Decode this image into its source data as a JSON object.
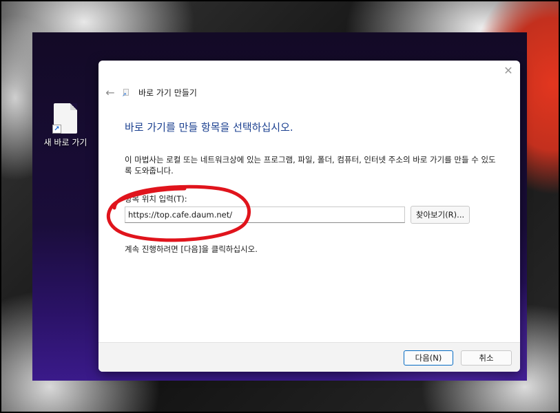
{
  "desktop": {
    "icon_label": "새 바로 가기"
  },
  "dialog": {
    "close_glyph": "✕",
    "back_glyph": "←",
    "title": "바로 가기 만들기",
    "heading": "바로 가기를 만들 항목을 선택하십시오.",
    "description": "이 마법사는 로컬 또는 네트워크상에 있는 프로그램, 파일, 폴더, 컴퓨터, 인터넷 주소의 바로 가기를 만들 수 있도록 도와줍니다.",
    "field_label": "항목 위치 입력(T):",
    "location_value": "https://top.cafe.daum.net/",
    "browse_label": "찾아보기(R)...",
    "instruction": "계속 진행하려면 [다음]을 클릭하십시오.",
    "next_label": "다음(N)",
    "cancel_label": "취소"
  },
  "colors": {
    "annotation": "#e0141c",
    "heading": "#1a3f8f",
    "accent_border": "#0067c0"
  }
}
